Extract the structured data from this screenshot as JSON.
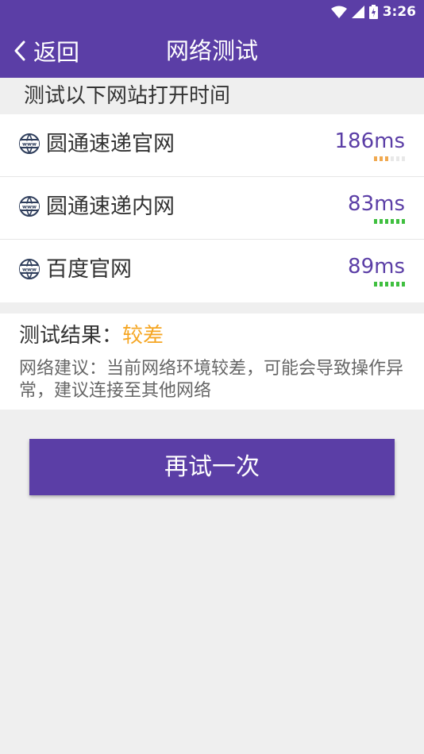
{
  "status_bar": {
    "time": "3:26"
  },
  "header": {
    "back_label": "返回",
    "title": "网络测试"
  },
  "section_caption": "测试以下网站打开时间",
  "sites": [
    {
      "name": "圆通速递官网",
      "latency": "186ms",
      "signal_level": 3,
      "signal_max": 6,
      "signal_color": "#f0a950"
    },
    {
      "name": "圆通速递内网",
      "latency": "83ms",
      "signal_level": 6,
      "signal_max": 6,
      "signal_color": "#3fbf3f"
    },
    {
      "name": "百度官网",
      "latency": "89ms",
      "signal_level": 6,
      "signal_max": 6,
      "signal_color": "#3fbf3f"
    }
  ],
  "result": {
    "label": "测试结果：",
    "level": "较差",
    "advice": "网络建议：当前网络环境较差，可能会导致操作异常，建议连接至其他网络"
  },
  "retry_button": "再试一次",
  "colors": {
    "accent": "#5b3ea6",
    "warning": "#f5a623",
    "good": "#3fbf3f"
  }
}
